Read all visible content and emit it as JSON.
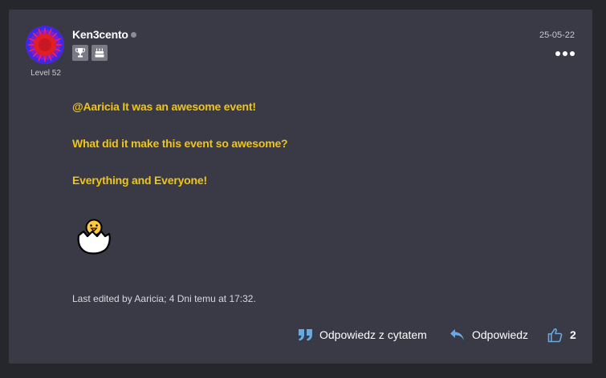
{
  "post": {
    "author": "Ken3cento",
    "level_label": "Level 52",
    "date": "25-05-22",
    "badges": [
      "trophy-icon",
      "cake-icon"
    ],
    "message_lines": [
      "@Aaricia It was an awesome event!",
      "What did it make this event so awesome?",
      "Everything and Everyone!"
    ],
    "emoji": "hatching-chick-icon",
    "edited_note": "Last edited by Aaricia; 4 Dni temu at 17:32."
  },
  "actions": {
    "quote_reply_label": "Odpowiedz z cytatem",
    "reply_label": "Odpowiedz",
    "like_count": "2"
  },
  "colors": {
    "page_bg": "#26272d",
    "card_bg": "#393a46",
    "message_text": "#f0c419",
    "action_icon": "#6aa8e0"
  }
}
